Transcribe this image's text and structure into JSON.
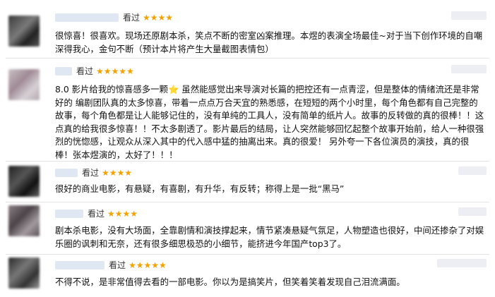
{
  "reviews": [
    {
      "label": "看过",
      "stars": "★★★★",
      "text": "很惊喜！很喜欢。现场还原剧本杀，笑点不断的密室凶案推理。本煜的表演全场最佳~对于当下创作环境的自嘲深得我心，金句不断（预计本片将产生大量截图表情包）"
    },
    {
      "label": "看过",
      "stars": "★★★★★",
      "text": "8.0 影片给我的惊喜感多一颗⭐ 虽然能感觉出来导演对长篇的把控还有一点青涩，但是整体的情绪流还是非常好的 编剧团队真的太多惊喜，带着一点点万合天宜的熟悉感，在短短的两个小时里，每个角色都有自己完整的故事，每个角色都是让人能够记住的，没有单纯的工具人，没有简单的纸片人。故事的反转做的真的很棒！！这点真的给我很多惊喜！！不太多剧透了。影片最后的结局，让人突然能够回忆起整个故事开始前，给人一种很强烈的恍惚感，让观众从深入其中的代入感中猛的抽离出来。真的很爱！ 另外夸一下各位演员的演技，真的很棒！张本煜演的，太好了！！！"
    },
    {
      "label": "看过",
      "stars": "★★★★",
      "text": "很好的商业电影，有悬疑，有喜剧，有升华，有反转；称得上是一批“黑马”"
    },
    {
      "label": "看过",
      "stars": "★★★★",
      "text": "剧本杀电影，没有大场面，全靠剧情和演技撑起来，情节紧凑悬疑气氛足，人物塑造也很好，中间还掺杂了对娱乐圈的讽刺和无奈，还有很多细思极恐的小细节，能挤进今年国产top3了。"
    },
    {
      "label": "看过",
      "stars": "★★★★★",
      "text": "不得不说，是非常值得去看的一部电影。你以为是搞笑片，但笑着笑着发现自己泪流满面。"
    }
  ]
}
